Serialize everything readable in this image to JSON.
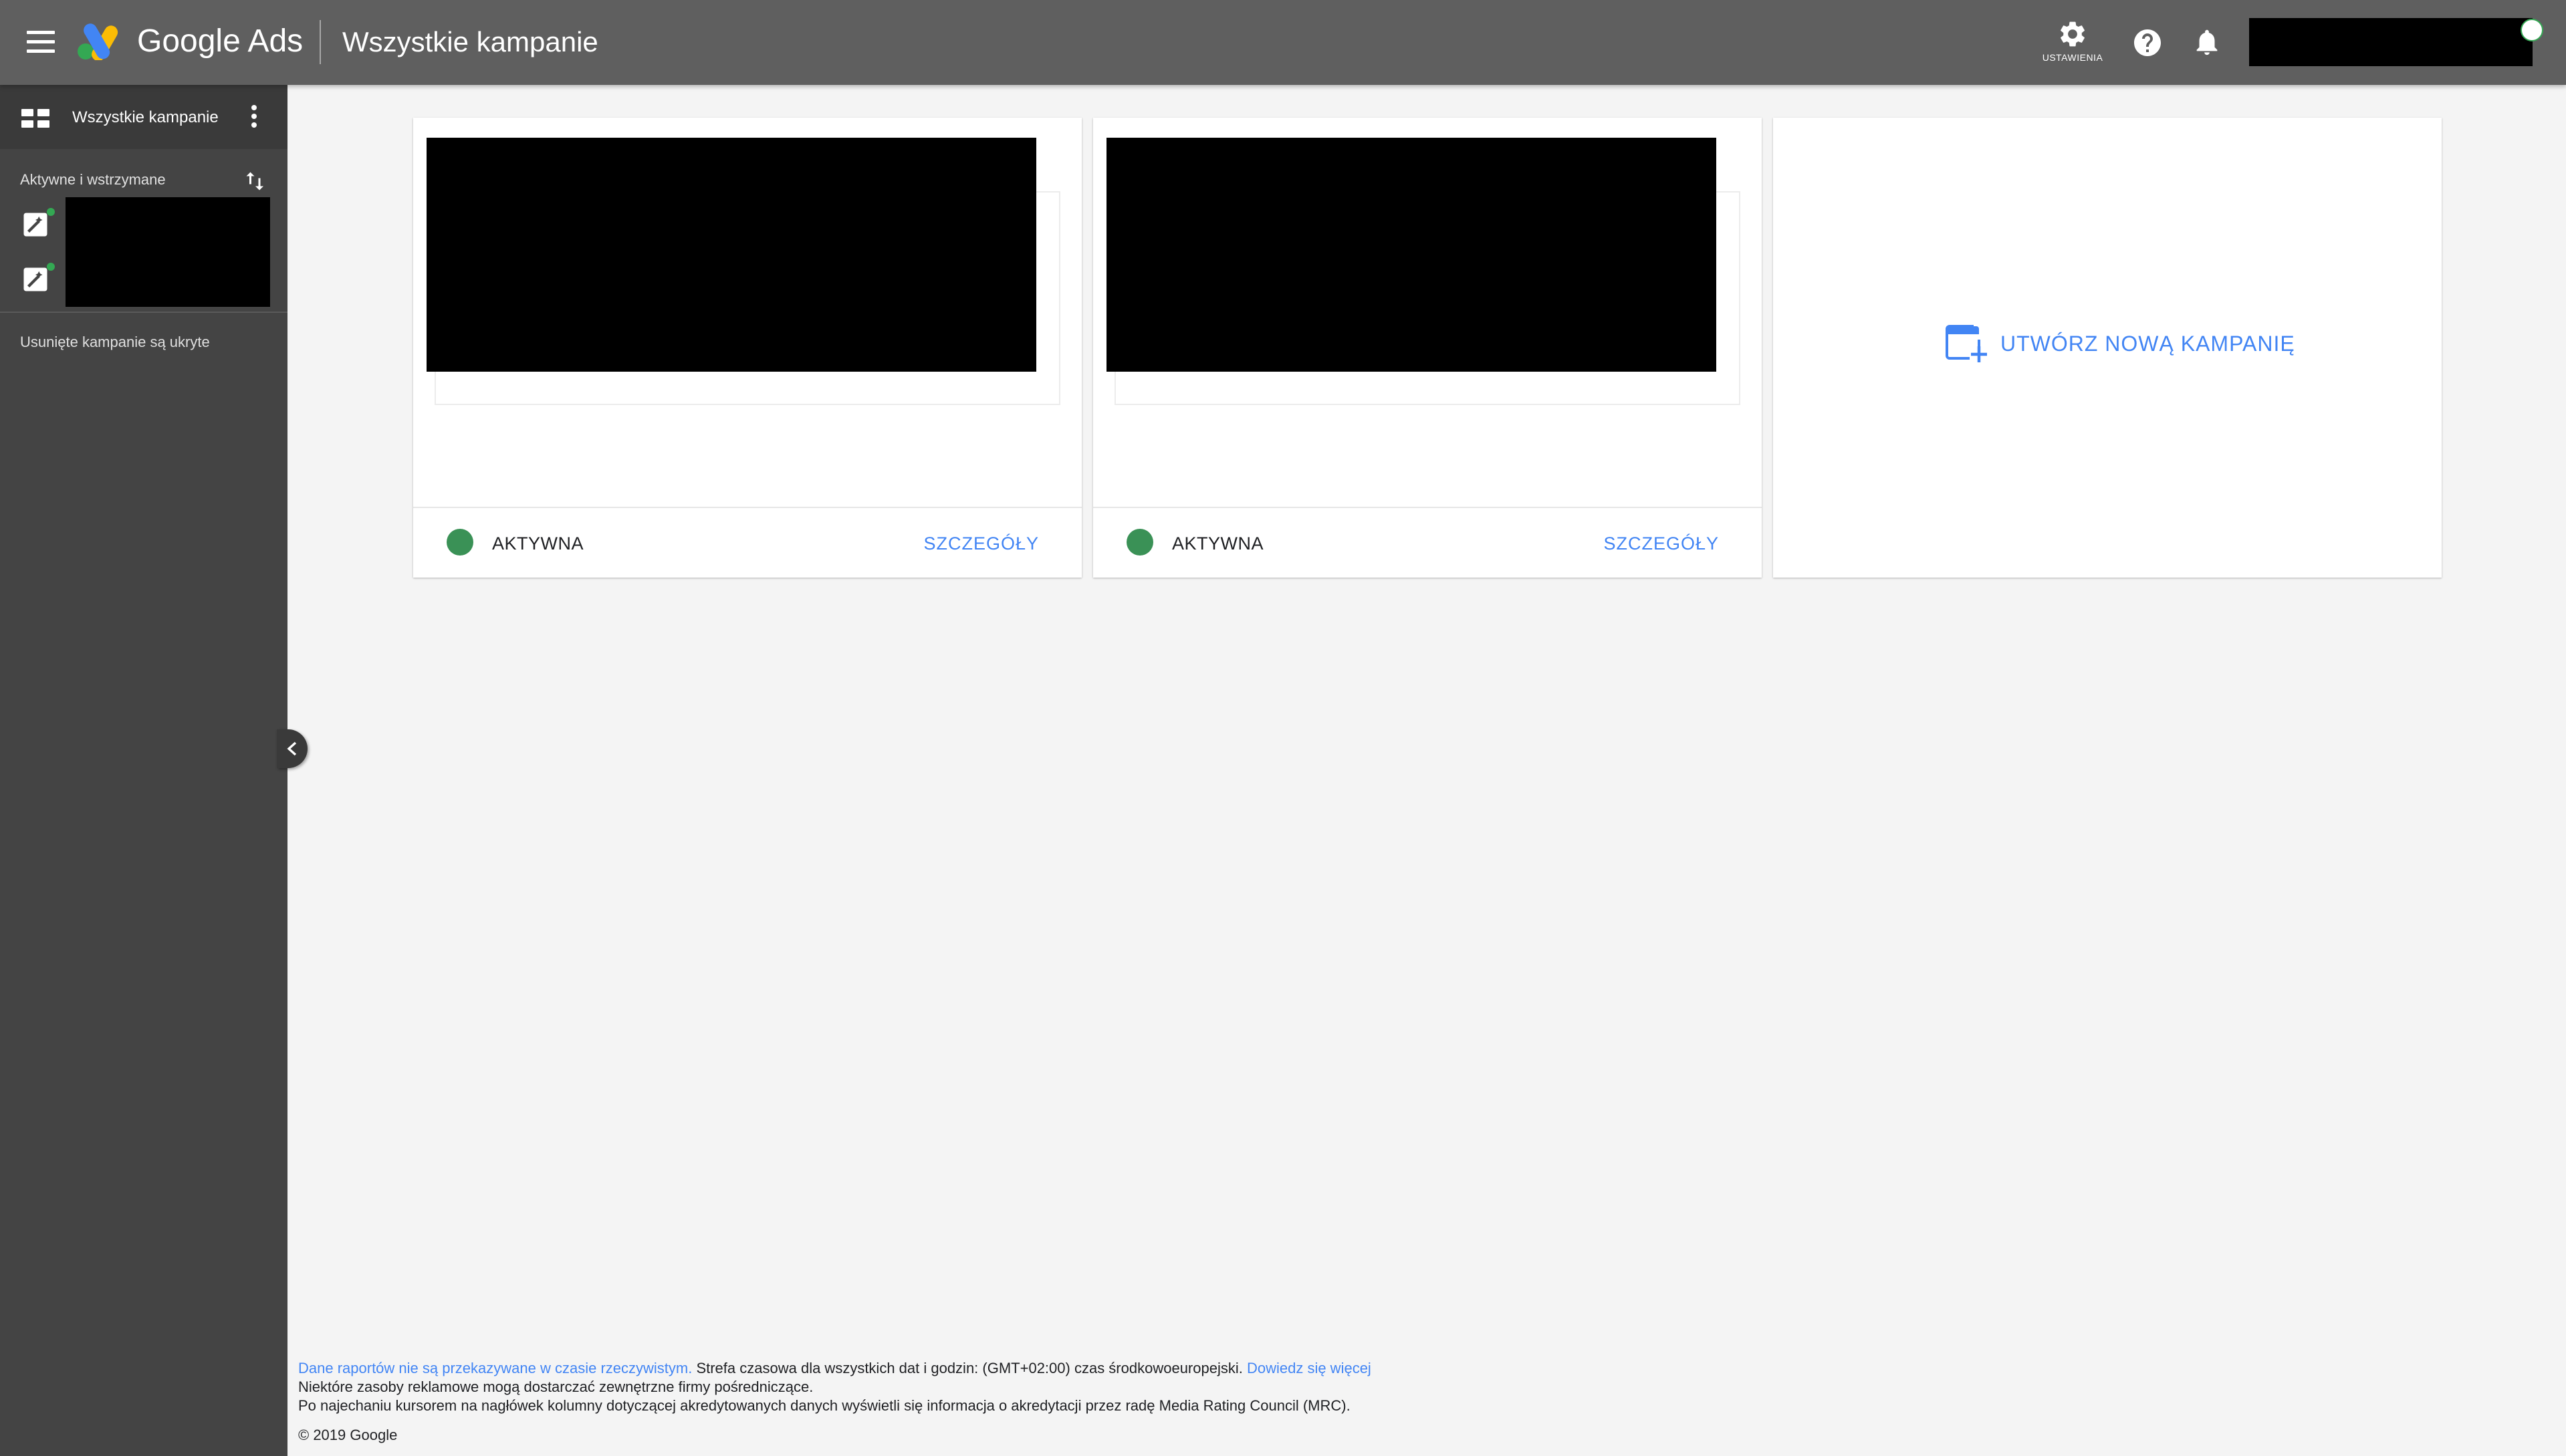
{
  "app": {
    "brand": "Google Ads",
    "page_title": "Wszystkie kampanie"
  },
  "header": {
    "settings_label": "USTAWIENIA",
    "settings_icon": "gear-icon",
    "help_icon": "help-circle-icon",
    "notifications_icon": "bell-icon",
    "menu_icon": "hamburger-menu-icon"
  },
  "sidebar": {
    "header_label": "Wszystkie kampanie",
    "filter_label": "Aktywne i wstrzymane",
    "hidden_note": "Usunięte kampanie są ukryte",
    "campaign_icon": "magic-wand-icon"
  },
  "cards": [
    {
      "status": "AKTYWNA",
      "details_label": "SZCZEGÓŁY",
      "status_color": "#3a9156"
    },
    {
      "status": "AKTYWNA",
      "details_label": "SZCZEGÓŁY",
      "status_color": "#3a9156"
    }
  ],
  "create_card": {
    "label": "UTWÓRZ NOWĄ KAMPANIĘ",
    "icon": "add-window-icon"
  },
  "footer": {
    "line1_link": "Dane raportów nie są przekazywane w czasie rzeczywistym.",
    "line1_text": " Strefa czasowa dla wszystkich dat i godzin: (GMT+02:00) czas środkowoeuropejski. ",
    "line1_more": "Dowiedz się więcej",
    "line2": "Niektóre zasoby reklamowe mogą dostarczać zewnętrzne firmy pośredniczące.",
    "line3": "Po najechaniu kursorem na nagłówek kolumny dotyczącej akredytowanych danych wyświetli się informacja o akredytacji przez radę Media Rating Council (MRC).",
    "copyright": "© 2019 Google"
  },
  "colors": {
    "topbar": "#5f5f5f",
    "sidebar": "#444444",
    "accent_blue": "#4285f4",
    "status_green": "#3a9156"
  }
}
